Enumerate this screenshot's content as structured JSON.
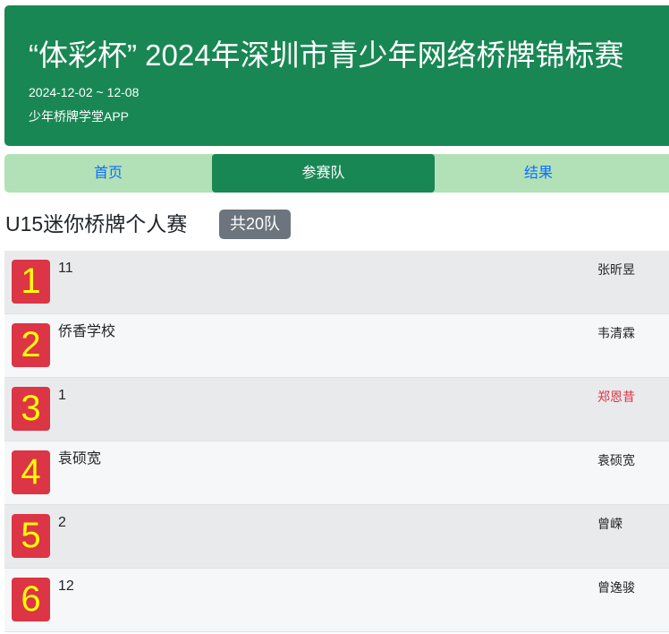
{
  "banner": {
    "title": "“体彩杯” 2024年深圳市青少年网络桥牌锦标赛",
    "date": "2024-12-02 ~ 12-08",
    "subtitle": "少年桥牌学堂APP"
  },
  "tabs": {
    "home": "首页",
    "teams": "参赛队",
    "results": "结果"
  },
  "section": {
    "title": "U15迷你桥牌个人赛",
    "count_badge": "共20队"
  },
  "colors": {
    "brand_green": "#198754",
    "tab_bar": "#b2e1b8",
    "rank_badge": "#dc3545",
    "rank_text": "#ffff00",
    "highlight_player": "#dc3545"
  },
  "teams": [
    {
      "rank": "1",
      "name": "11",
      "player": "张昕昱",
      "highlight": false
    },
    {
      "rank": "2",
      "name": "侨香学校",
      "player": "韦清霖",
      "highlight": false
    },
    {
      "rank": "3",
      "name": "1",
      "player": "郑恩昔",
      "highlight": true
    },
    {
      "rank": "4",
      "name": "袁硕宽",
      "player": "袁硕宽",
      "highlight": false
    },
    {
      "rank": "5",
      "name": "2",
      "player": "曾嵘",
      "highlight": false
    },
    {
      "rank": "6",
      "name": "12",
      "player": "曾逸骏",
      "highlight": false
    }
  ]
}
